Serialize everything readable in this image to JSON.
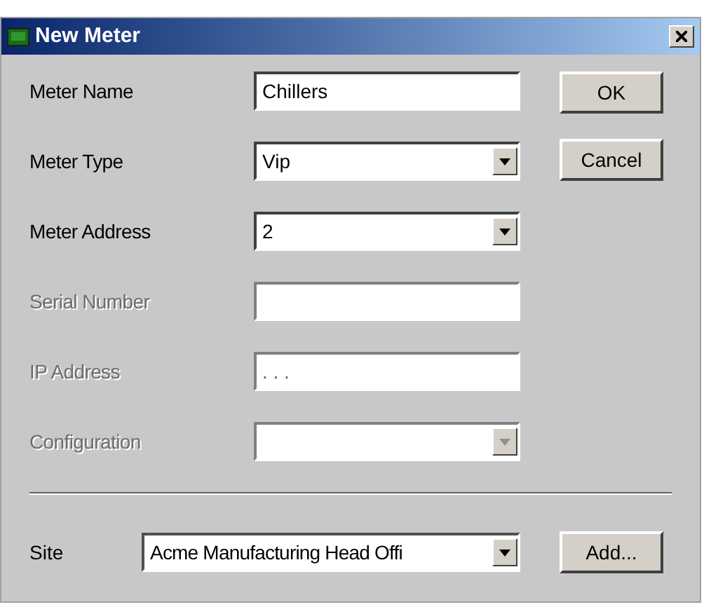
{
  "window": {
    "title": "New Meter"
  },
  "fields": [
    {
      "label": "Meter Name",
      "kind": "text",
      "value": "Chillers",
      "disabled": false
    },
    {
      "label": "Meter Type",
      "kind": "combo",
      "value": "Vip",
      "disabled": false
    },
    {
      "label": "Meter Address",
      "kind": "combo",
      "value": "2",
      "disabled": false
    },
    {
      "label": "Serial Number",
      "kind": "text",
      "disabled": true
    },
    {
      "label": "IP Address",
      "kind": "text",
      "value": ". . .",
      "disabled": true
    },
    {
      "label": "Configuration",
      "kind": "combo",
      "disabled": true
    }
  ],
  "buttons": [
    "OK",
    "Cancel"
  ],
  "site": {
    "label": "Site",
    "value": "Acme Manufacturing Head Offi",
    "button": "Add..."
  }
}
